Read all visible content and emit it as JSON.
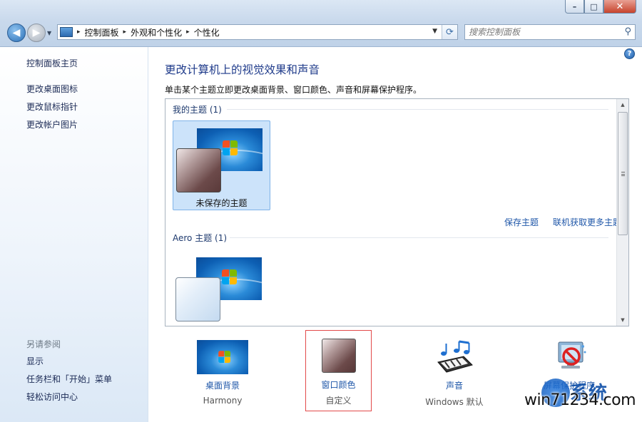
{
  "window": {
    "controls": {
      "minimize": "–",
      "maximize": "□",
      "close": "✕"
    }
  },
  "nav": {
    "back_icon": "back-arrow-icon",
    "forward_icon": "forward-arrow-icon",
    "breadcrumb": [
      "控制面板",
      "外观和个性化",
      "个性化"
    ],
    "separator": "▸"
  },
  "search": {
    "placeholder": "搜索控制面板"
  },
  "sidebar": {
    "home": "控制面板主页",
    "links": [
      "更改桌面图标",
      "更改鼠标指针",
      "更改帐户图片"
    ],
    "see_also_title": "另请参阅",
    "see_also": [
      "显示",
      "任务栏和「开始」菜单",
      "轻松访问中心"
    ]
  },
  "main": {
    "help": "?",
    "title": "更改计算机上的视觉效果和声音",
    "subtitle": "单击某个主题立即更改桌面背景、窗口颜色、声音和屏幕保护程序。",
    "groups": [
      {
        "title": "我的主题 (1)",
        "themes": [
          {
            "label": "未保存的主题",
            "selected": true
          }
        ]
      },
      {
        "title": "Aero 主题 (1)",
        "themes": [
          {
            "label": "",
            "selected": false
          }
        ]
      }
    ],
    "save_theme": "保存主题",
    "get_more": "联机获取更多主题"
  },
  "shortcuts": [
    {
      "name": "桌面背景",
      "value": "Harmony"
    },
    {
      "name": "窗口颜色",
      "value": "自定义"
    },
    {
      "name": "声音",
      "value": "Windows 默认"
    },
    {
      "name": "屏幕保护程序",
      "value": ""
    }
  ],
  "watermark": {
    "text": "win71234.com",
    "big": "系统"
  },
  "colors": {
    "link": "#1e56a8",
    "title": "#1e3a8a",
    "selected": "#cce3fa",
    "highlight_border": "#e24a4a"
  }
}
